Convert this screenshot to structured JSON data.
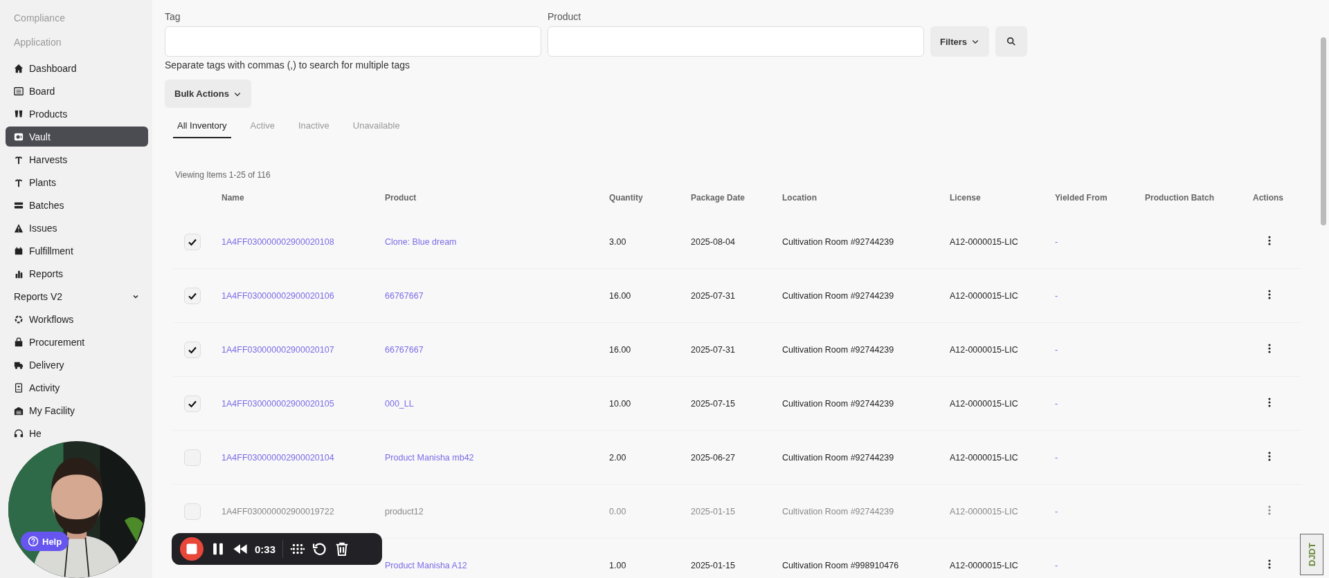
{
  "sidebar": {
    "sections": [
      "Compliance",
      "Application"
    ],
    "items": [
      {
        "label": "Dashboard",
        "selected": false
      },
      {
        "label": "Board",
        "selected": false
      },
      {
        "label": "Products",
        "selected": false
      },
      {
        "label": "Vault",
        "selected": true
      },
      {
        "label": "Harvests",
        "selected": false
      },
      {
        "label": "Plants",
        "selected": false
      },
      {
        "label": "Batches",
        "selected": false
      },
      {
        "label": "Issues",
        "selected": false
      },
      {
        "label": "Fulfillment",
        "selected": false
      },
      {
        "label": "Reports",
        "selected": false
      },
      {
        "label": "Reports V2",
        "selected": false,
        "kind": "group",
        "expanded": false
      },
      {
        "label": "Workflows",
        "selected": false
      },
      {
        "label": "Procurement",
        "selected": false
      },
      {
        "label": "Delivery",
        "selected": false
      },
      {
        "label": "Activity",
        "selected": false
      },
      {
        "label": "My Facility",
        "selected": false
      },
      {
        "label": "He",
        "selected": false
      }
    ]
  },
  "filters": {
    "tag_label": "Tag",
    "product_label": "Product",
    "filters_button": "Filters",
    "hint": "Separate tags with commas (,) to search for multiple tags"
  },
  "bulk_actions": "Bulk Actions",
  "tabs": [
    {
      "label": "All Inventory",
      "selected": true
    },
    {
      "label": "Active",
      "selected": false
    },
    {
      "label": "Inactive",
      "selected": false
    },
    {
      "label": "Unavailable",
      "selected": false
    }
  ],
  "viewing": "Viewing Items 1-25 of 116",
  "table": {
    "columns": [
      "Name",
      "Product",
      "Quantity",
      "Package Date",
      "Location",
      "License",
      "Yielded From",
      "Production Batch",
      "Actions"
    ],
    "rows": [
      {
        "checked": true,
        "inactive": false,
        "name": "1A4FF030000002900020108",
        "product": "Clone: Blue dream",
        "quantity": "3.00",
        "date": "2025-08-04",
        "location": "Cultivation Room #92744239",
        "license": "A12-0000015-LIC",
        "yielded": "-"
      },
      {
        "checked": true,
        "inactive": false,
        "name": "1A4FF030000002900020106",
        "product": "66767667",
        "quantity": "16.00",
        "date": "2025-07-31",
        "location": "Cultivation Room #92744239",
        "license": "A12-0000015-LIC",
        "yielded": "-"
      },
      {
        "checked": true,
        "inactive": false,
        "name": "1A4FF030000002900020107",
        "product": "66767667",
        "quantity": "16.00",
        "date": "2025-07-31",
        "location": "Cultivation Room #92744239",
        "license": "A12-0000015-LIC",
        "yielded": "-"
      },
      {
        "checked": true,
        "inactive": false,
        "name": "1A4FF030000002900020105",
        "product": "000_LL",
        "quantity": "10.00",
        "date": "2025-07-15",
        "location": "Cultivation Room #92744239",
        "license": "A12-0000015-LIC",
        "yielded": "-"
      },
      {
        "checked": false,
        "inactive": false,
        "name": "1A4FF030000002900020104",
        "product": "Product Manisha mb42",
        "quantity": "2.00",
        "date": "2025-06-27",
        "location": "Cultivation Room #92744239",
        "license": "A12-0000015-LIC",
        "yielded": "-"
      },
      {
        "checked": false,
        "inactive": true,
        "name": "1A4FF030000002900019722",
        "product": "product12",
        "quantity": "0.00",
        "date": "2025-01-15",
        "location": "Cultivation Room #92744239",
        "license": "A12-0000015-LIC",
        "yielded": "-"
      },
      {
        "inactive": false,
        "product": "Product Manisha A12",
        "quantity": "1.00",
        "date": "2025-01-15",
        "location": "Cultivation Room #998910476",
        "license": "A12-0000015-LIC",
        "yielded": "-"
      }
    ]
  },
  "help_button": "Help",
  "recorder": {
    "time": "0:33"
  },
  "debug_toolbar": "DJDT"
}
